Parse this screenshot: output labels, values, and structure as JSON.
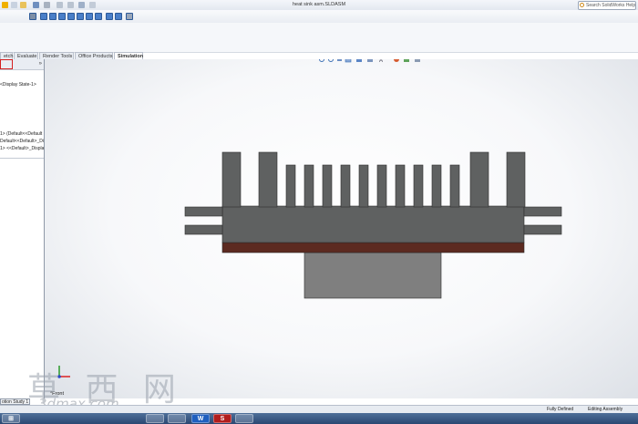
{
  "window": {
    "title": "heat sink asm.SLDASM"
  },
  "search": {
    "placeholder": "Search SolidWorks Help"
  },
  "tabs": [
    {
      "label": "etch"
    },
    {
      "label": "Evaluate"
    },
    {
      "label": "Render Tools"
    },
    {
      "label": "Office Products"
    },
    {
      "label": "Simulation"
    }
  ],
  "feature_tree": {
    "lines": [
      "<Display State-1>",
      "1> (Default<<Default",
      "Default<<Default>_Di",
      "1> <<Default>_Displa"
    ]
  },
  "motion_study": {
    "label": "otion Study 1"
  },
  "triad": {
    "label": "*Front"
  },
  "status": {
    "left": "Fully Defined",
    "right": "Editing Assembly"
  },
  "watermark": {
    "cjk": "草 西 网",
    "url": "3dmax.com"
  },
  "model": {
    "colors": {
      "heatsink": "#5f6161",
      "pad": "#5c2a20",
      "chip": "#7f7f7f",
      "outline": "#2c2c2c"
    }
  }
}
